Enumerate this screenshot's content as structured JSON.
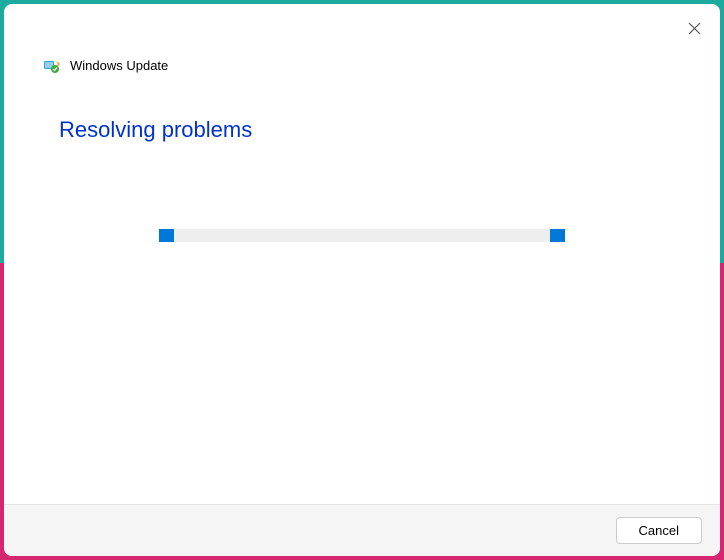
{
  "header": {
    "title": "Windows Update",
    "icon": "windows-update-icon"
  },
  "main": {
    "title": "Resolving problems"
  },
  "footer": {
    "cancel_label": "Cancel"
  },
  "colors": {
    "accent": "#0078d7",
    "title_link": "#0033cc"
  }
}
